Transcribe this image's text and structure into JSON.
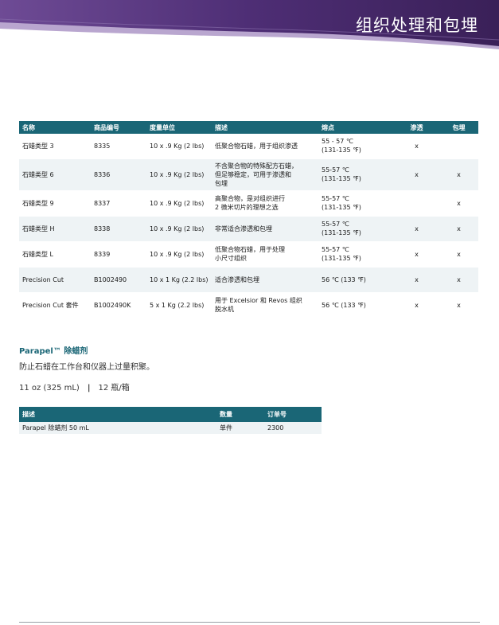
{
  "header": {
    "title": "组织处理和包埋",
    "colors": {
      "purple_dark": "#3d2560",
      "purple_mid": "#5c3a82",
      "purple_light": "#7a569e"
    }
  },
  "main_table": {
    "columns": [
      "名称",
      "商品编号",
      "度量单位",
      "描述",
      "熔点",
      "渗透",
      "包埋"
    ],
    "rows": [
      {
        "name": "石蜡类型 3",
        "code": "8335",
        "unit": "10 x .9 Kg (2 lbs)",
        "desc": [
          "低聚合物石蜡，用于组织渗透"
        ],
        "melt": [
          "55 - 57 ℃",
          "(131-135 ℉)"
        ],
        "infil": "x",
        "embed": ""
      },
      {
        "name": "石蜡类型 6",
        "code": "8336",
        "unit": "10 x .9 Kg (2 lbs)",
        "desc": [
          "不含聚合物的特殊配方石蜡，",
          "但足够稳定，可用于渗透和",
          "包埋"
        ],
        "melt": [
          "55-57 ℃",
          "(131-135 ℉)"
        ],
        "infil": "x",
        "embed": "x"
      },
      {
        "name": "石蜡类型 9",
        "code": "8337",
        "unit": "10 x .9 Kg (2 lbs)",
        "desc": [
          "高聚合物，是对组织进行",
          "2 微米切片的理想之选"
        ],
        "melt": [
          "55-57 ℃",
          "(131-135 ℉)"
        ],
        "infil": "",
        "embed": "x"
      },
      {
        "name": "石蜡类型 H",
        "code": "8338",
        "unit": "10 x .9 Kg (2 lbs)",
        "desc": [
          "非常适合渗透和包埋"
        ],
        "melt": [
          "55-57 ℃",
          "(131-135 ℉)"
        ],
        "infil": "x",
        "embed": "x"
      },
      {
        "name": "石蜡类型 L",
        "code": "8339",
        "unit": "10 x .9 Kg (2 lbs)",
        "desc": [
          "低聚合物石蜡，用于处理",
          "小尺寸组织"
        ],
        "melt": [
          "55-57 ℃",
          "(131-135 ℉)"
        ],
        "infil": "x",
        "embed": "x"
      },
      {
        "name": "Precision Cut",
        "code": "B1002490",
        "unit": "10 x 1 Kg (2.2 lbs)",
        "desc": [
          "适合渗透和包埋"
        ],
        "melt": [
          "56 ℃ (133 ℉)"
        ],
        "infil": "x",
        "embed": "x"
      },
      {
        "name": "Precision Cut 套件",
        "code": "B1002490K",
        "unit": "5 x 1 Kg (2.2 lbs)",
        "desc": [
          "用于 Excelsior 和 Revos 组织",
          "脱水机"
        ],
        "melt": [
          "56 ℃ (133 ℉)"
        ],
        "infil": "x",
        "embed": "x"
      }
    ]
  },
  "parapel": {
    "title": "Parapel™ 除蜡剂",
    "description": "防止石蜡在工作台和仪器上过量积聚。",
    "size": "11 oz (325 mL)",
    "separator": "|",
    "pack": "12 瓶/箱"
  },
  "small_table": {
    "columns": [
      "描述",
      "数量",
      "订单号"
    ],
    "rows": [
      {
        "desc": "Parapel 除蜡剂 50 mL",
        "qty": "单件",
        "order": "2300"
      }
    ]
  }
}
